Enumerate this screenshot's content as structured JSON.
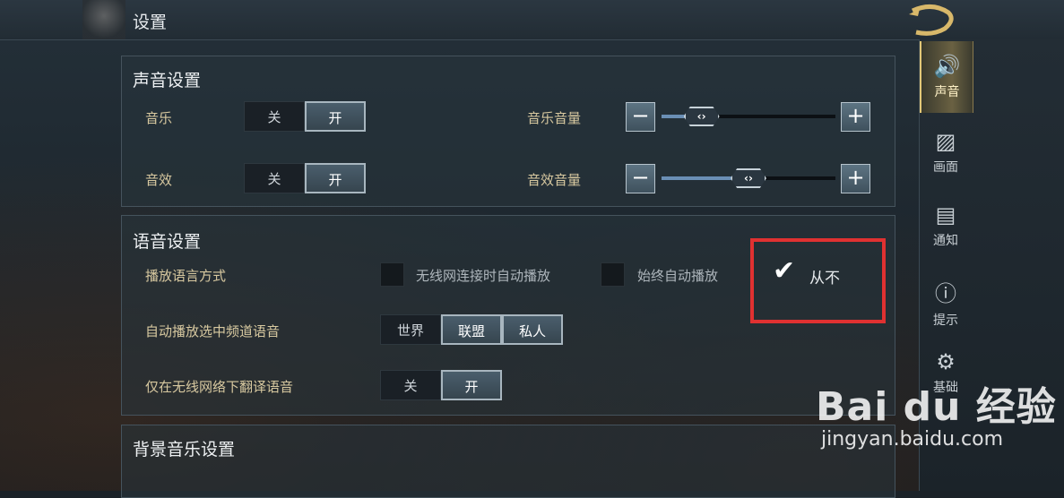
{
  "header": {
    "title": "设置"
  },
  "sound": {
    "title": "声音设置",
    "music": {
      "label": "音乐",
      "off": "关",
      "on": "开",
      "selected": "开"
    },
    "sfx": {
      "label": "音效",
      "off": "关",
      "on": "开",
      "selected": "开"
    },
    "music_volume": {
      "label": "音乐音量",
      "minus": "−",
      "plus": "+",
      "level_fraction": 0.23
    },
    "sfx_volume": {
      "label": "音效音量",
      "minus": "−",
      "plus": "+",
      "level_fraction": 0.5
    }
  },
  "voice": {
    "title": "语音设置",
    "playback_mode": {
      "label": "播放语言方式",
      "opt_wifi": "无线网连接时自动播放",
      "opt_always": "始终自动播放",
      "opt_never": "从不",
      "selected": "从不"
    },
    "auto_channel": {
      "label": "自动播放选中频道语音",
      "options": [
        "世界",
        "联盟",
        "私人"
      ],
      "selected": [
        "联盟",
        "私人"
      ]
    },
    "translate_wifi": {
      "label": "仅在无线网络下翻译语音",
      "off": "关",
      "on": "开",
      "selected": "开"
    }
  },
  "bgm": {
    "title": "背景音乐设置"
  },
  "sidebar": {
    "items": [
      {
        "label": "声音",
        "icon": "speaker-icon",
        "glyph": "🔊",
        "active": true
      },
      {
        "label": "画面",
        "icon": "image-icon",
        "glyph": "▨",
        "active": false
      },
      {
        "label": "通知",
        "icon": "chat-icon",
        "glyph": "▤",
        "active": false
      },
      {
        "label": "提示",
        "icon": "alert-icon",
        "glyph": "ⓘ",
        "active": false
      },
      {
        "label": "基础",
        "icon": "gear-icon",
        "glyph": "⚙",
        "active": false
      }
    ]
  },
  "watermark": {
    "brand": "Bai  du 经验",
    "url": "jingyan.baidu.com"
  },
  "colors": {
    "accent_gold": "#e3c878",
    "highlight_red": "#e03131",
    "slider_fill": "#6a8fb5"
  }
}
